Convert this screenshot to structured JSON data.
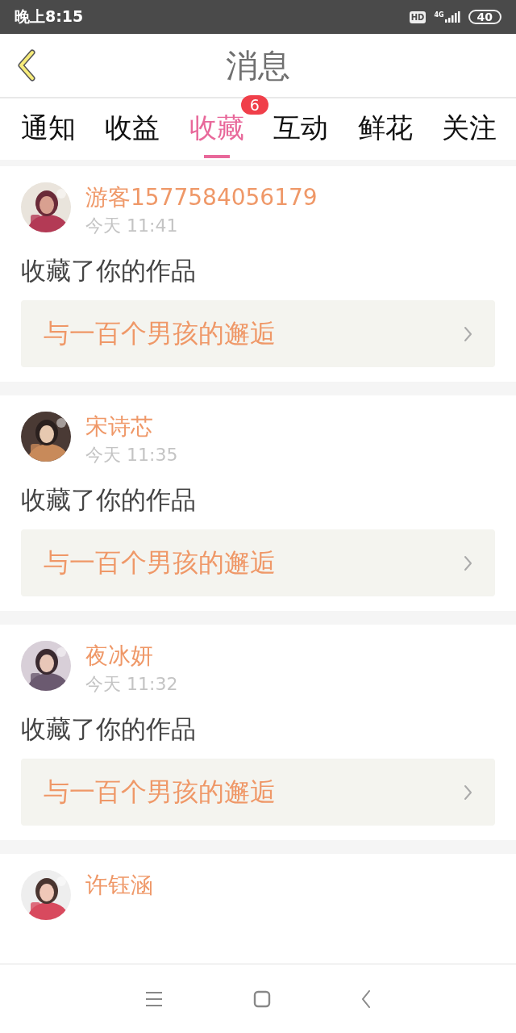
{
  "status_bar": {
    "time": "晚上8:15",
    "hd": "HD",
    "network": "4G",
    "battery": "40"
  },
  "header": {
    "title": "消息"
  },
  "tabs": [
    {
      "label": "通知",
      "selected": false
    },
    {
      "label": "收益",
      "selected": false
    },
    {
      "label": "收藏",
      "selected": true,
      "badge": "6"
    },
    {
      "label": "互动",
      "selected": false
    },
    {
      "label": "鲜花",
      "selected": false
    },
    {
      "label": "关注",
      "selected": false
    }
  ],
  "messages": [
    {
      "name": "游客1577584056179",
      "time": "今天 11:41",
      "action": "收藏了你的作品",
      "work": "与一百个男孩的邂逅"
    },
    {
      "name": "宋诗芯",
      "time": "今天 11:35",
      "action": "收藏了你的作品",
      "work": "与一百个男孩的邂逅"
    },
    {
      "name": "夜冰妍",
      "time": "今天 11:32",
      "action": "收藏了你的作品",
      "work": "与一百个男孩的邂逅"
    },
    {
      "name": "许钰涵"
    }
  ]
}
